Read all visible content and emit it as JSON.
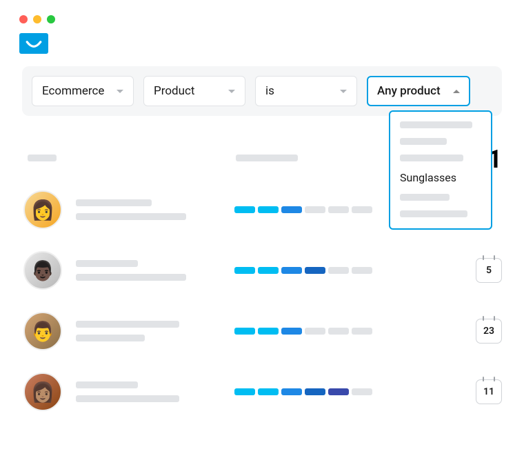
{
  "filters": {
    "category": "Ecommerce",
    "entity": "Product",
    "operator": "is",
    "value": "Any product",
    "options": {
      "visible_label": "Sunglasses"
    }
  },
  "big_number": "1",
  "rows": [
    {
      "bars": [
        "cyan",
        "cyan",
        "blue",
        "gray",
        "gray",
        "gray"
      ],
      "date": null
    },
    {
      "bars": [
        "cyan",
        "cyan",
        "blue",
        "dblue",
        "gray",
        "gray"
      ],
      "date": "5"
    },
    {
      "bars": [
        "cyan",
        "cyan",
        "blue",
        "gray",
        "gray",
        "gray"
      ],
      "date": "23"
    },
    {
      "bars": [
        "cyan",
        "cyan",
        "blue",
        "dblue",
        "indigo",
        "gray"
      ],
      "date": "11"
    }
  ]
}
